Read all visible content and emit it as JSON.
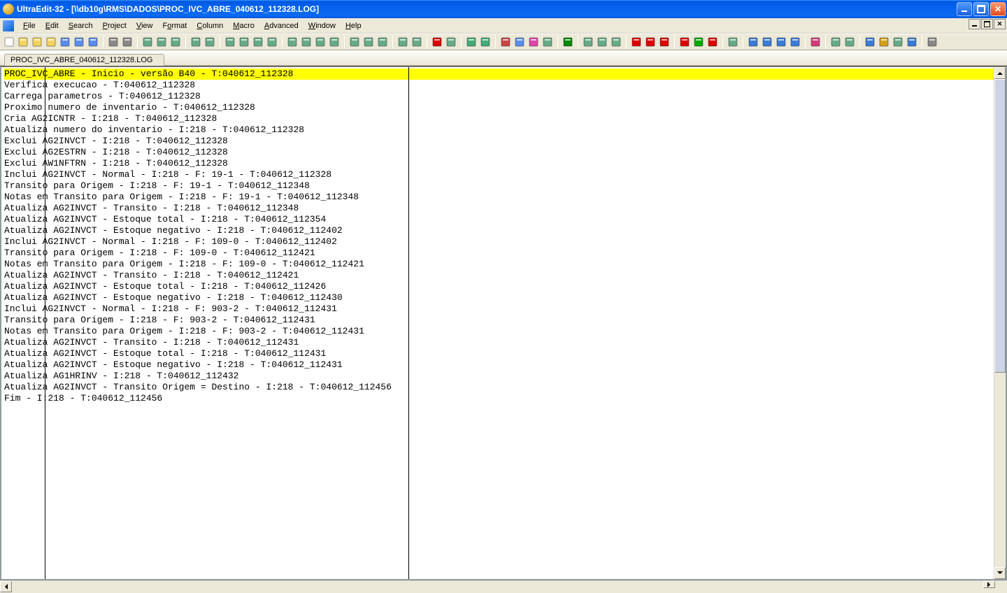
{
  "title": "UltraEdit-32 - [\\\\db10g\\RMS\\DADOS\\PROC_IVC_ABRE_040612_112328.LOG]",
  "menus": {
    "file": "File",
    "edit": "Edit",
    "search": "Search",
    "project": "Project",
    "view": "View",
    "format": "Format",
    "column": "Column",
    "macro": "Macro",
    "advanced": "Advanced",
    "window": "Window",
    "help": "Help"
  },
  "tab_name": "PROC_IVC_ABRE_040612_112328.LOG",
  "highlighted_line": "PROC_IVC_ABRE - Inicio - versão B40 - T:040612_112328",
  "lines": [
    "Verifica execucao - T:040612_112328",
    "Carrega parametros - T:040612_112328",
    "Proximo numero de inventario - T:040612_112328",
    "Cria AG2ICNTR - I:218 - T:040612_112328",
    "Atualiza numero do inventario - I:218 - T:040612_112328",
    "Exclui AG2INVCT - I:218 - T:040612_112328",
    "Exclui AG2ESTRN - I:218 - T:040612_112328",
    "Exclui AW1NFTRN - I:218 - T:040612_112328",
    "Inclui AG2INVCT - Normal - I:218 - F: 19-1 - T:040612_112328",
    "Transito para Origem - I:218 - F: 19-1 - T:040612_112348",
    "Notas em Transito para Origem - I:218 - F: 19-1 - T:040612_112348",
    "Atualiza AG2INVCT - Transito - I:218 - T:040612_112348",
    "Atualiza AG2INVCT - Estoque total - I:218 - T:040612_112354",
    "Atualiza AG2INVCT - Estoque negativo - I:218 - T:040612_112402",
    "Inclui AG2INVCT - Normal - I:218 - F: 109-0 - T:040612_112402",
    "Transito para Origem - I:218 - F: 109-0 - T:040612_112421",
    "Notas em Transito para Origem - I:218 - F: 109-0 - T:040612_112421",
    "Atualiza AG2INVCT - Transito - I:218 - T:040612_112421",
    "Atualiza AG2INVCT - Estoque total - I:218 - T:040612_112426",
    "Atualiza AG2INVCT - Estoque negativo - I:218 - T:040612_112430",
    "Inclui AG2INVCT - Normal - I:218 - F: 903-2 - T:040612_112431",
    "Transito para Origem - I:218 - F: 903-2 - T:040612_112431",
    "Notas em Transito para Origem - I:218 - F: 903-2 - T:040612_112431",
    "Atualiza AG2INVCT - Transito - I:218 - T:040612_112431",
    "Atualiza AG2INVCT - Estoque total - I:218 - T:040612_112431",
    "Atualiza AG2INVCT - Estoque negativo - I:218 - T:040612_112431",
    "Atualiza AG1HRINV - I:218 - T:040612_112432",
    "Atualiza AG2INVCT - Transito Origem = Destino - I:218 - T:040612_112456",
    "Fim - I:218 - T:040612_112456"
  ],
  "toolbar_icons": [
    "new-file-icon",
    "open-file-icon",
    "close-file-icon",
    "open-recent-icon",
    "save-icon",
    "save-as-icon",
    "save-all-icon",
    "sep",
    "print-icon",
    "print-preview-icon",
    "sep",
    "copy-file1-icon",
    "copy-file2-icon",
    "copy-file3-icon",
    "sep",
    "clipboard1-icon",
    "clipboard2-icon",
    "sep",
    "dos-unix-icon",
    "unix-mac-icon",
    "dos-mac-icon",
    "dos-unix2-icon",
    "sep",
    "ascii-table-icon",
    "ebcdic-icon",
    "sort-asc-icon",
    "sort-desc-icon",
    "sep",
    "insert-template-icon",
    "web-preview-icon",
    "browser-icon",
    "sep",
    "clipboard-win-icon",
    "clipboard-user-icon",
    "sep",
    "delete-mark-icon",
    "bookmark-icon",
    "sep",
    "undo-icon",
    "redo-icon",
    "sep",
    "cut-icon",
    "copy-icon",
    "paste-icon",
    "clipboard-hist-icon",
    "sep",
    "goto-icon",
    "sep",
    "show-spaces-icon",
    "line-numbers-icon",
    "word-wrap-icon",
    "sep",
    "spell-check-icon",
    "delete-icon",
    "cancel-icon",
    "sep",
    "record-macro-icon",
    "play-macro-icon",
    "stop-macro-icon",
    "sep",
    "function-list-icon",
    "sep",
    "find-icon",
    "find-next-icon",
    "find-prev-icon",
    "find-in-files-icon",
    "sep",
    "replace-icon",
    "sep",
    "column-mode-icon",
    "sum-columns-icon",
    "sep",
    "html-tidy-icon",
    "run-tool-icon",
    "ctags-icon",
    "refresh-icon",
    "sep",
    "config-icon"
  ]
}
